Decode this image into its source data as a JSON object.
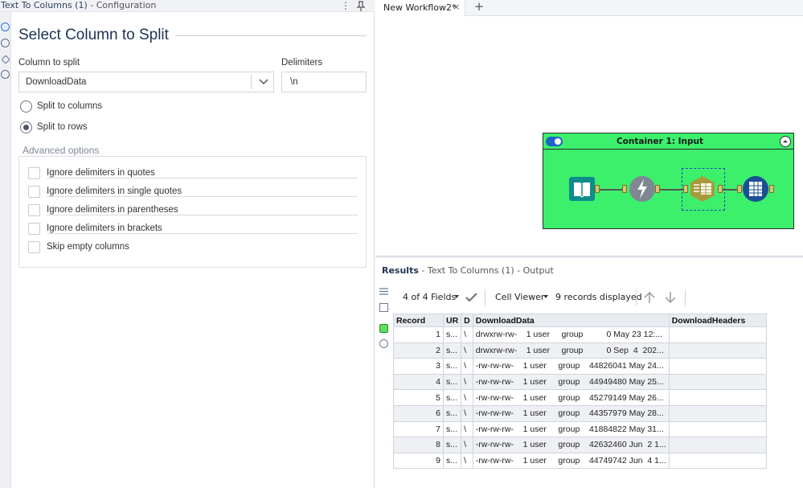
{
  "config": {
    "window_title": "Text To Columns (1)",
    "window_subtitle": " - Configuration",
    "heading": "Select Column to Split",
    "column_label": "Column to split",
    "column_value": "DownloadData",
    "delimiters_label": "Delimiters",
    "delimiters_value": "\\n",
    "radio_columns": "Split to columns",
    "radio_rows": "Split to rows",
    "selected_mode": "Split to rows",
    "advanced_title": "Advanced options",
    "checkboxes": [
      "Ignore delimiters in quotes",
      "Ignore delimiters in single quotes",
      "Ignore delimiters in parentheses",
      "Ignore delimiters in brackets",
      "Skip empty columns"
    ]
  },
  "workflow": {
    "tab_label": "New Workflow2*",
    "tab_close": "×",
    "tab_add": "+",
    "container_title": "Container 1: Input",
    "container_color": "#3cf06c",
    "tools": [
      "input-data-icon",
      "formula-icon",
      "text-to-columns-icon",
      "browse-icon"
    ]
  },
  "results": {
    "title": "Results",
    "subtitle": " - Text To Columns (1) - Output",
    "fields": "4 of 4 Fields",
    "viewer": "Cell Viewer",
    "records": "9 records displayed",
    "columns": [
      "Record",
      "UR",
      "D",
      "DownloadData",
      "DownloadHeaders"
    ],
    "rows": [
      [
        "1",
        "s...",
        "\\",
        "drwxrw-rw-    1 user     group          0 May 23 12:...",
        ""
      ],
      [
        "2",
        "s...",
        "\\",
        "drwxrw-rw-    1 user     group          0 Sep  4  202...",
        ""
      ],
      [
        "3",
        "s...",
        "\\",
        "-rw-rw-rw-    1 user     group    44826041 May 24...",
        ""
      ],
      [
        "4",
        "s...",
        "\\",
        "-rw-rw-rw-    1 user     group    44949480 May 25...",
        ""
      ],
      [
        "5",
        "s...",
        "\\",
        "-rw-rw-rw-    1 user     group    45279149 May 26...",
        ""
      ],
      [
        "6",
        "s...",
        "\\",
        "-rw-rw-rw-    1 user     group    44357979 May 28...",
        ""
      ],
      [
        "7",
        "s...",
        "\\",
        "-rw-rw-rw-    1 user     group    41884822 May 31...",
        ""
      ],
      [
        "8",
        "s...",
        "\\",
        "-rw-rw-rw-    1 user     group    42632460 Jun  2 1...",
        ""
      ],
      [
        "9",
        "s...",
        "\\",
        "-rw-rw-rw-    1 user     group    44749742 Jun  4 1...",
        ""
      ]
    ]
  }
}
